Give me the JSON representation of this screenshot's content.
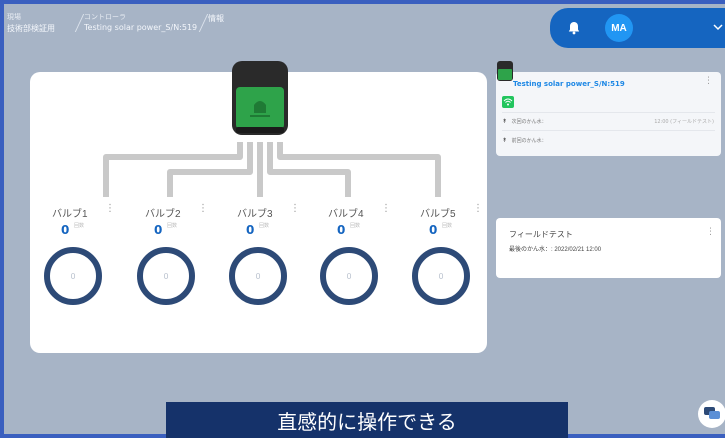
{
  "breadcrumb": [
    {
      "label": "現場",
      "value": "技術部検証用"
    },
    {
      "label": "コントローラ",
      "value": "Testing solar power_S/N:519"
    },
    {
      "label": "",
      "value": "情報"
    }
  ],
  "header": {
    "avatar_initials": "MA"
  },
  "valves": [
    {
      "name": "バルブ1",
      "count": "0",
      "unit": "回数",
      "gauge": "0"
    },
    {
      "name": "バルブ2",
      "count": "0",
      "unit": "回数",
      "gauge": "0"
    },
    {
      "name": "バルブ3",
      "count": "0",
      "unit": "回数",
      "gauge": "0"
    },
    {
      "name": "バルブ4",
      "count": "0",
      "unit": "回数",
      "gauge": "0"
    },
    {
      "name": "バルブ5",
      "count": "0",
      "unit": "回数",
      "gauge": "0"
    }
  ],
  "device_card": {
    "name": "Testing solar power_S/N:519",
    "rows": [
      {
        "label": "次回のかん水：",
        "value": "12:00 (フィールドテスト)"
      },
      {
        "label": "前回のかん水：",
        "value": ""
      }
    ]
  },
  "schedule_card": {
    "title": "フィールドテスト",
    "last_label": "最後のかん水：",
    "last_value": ": 2022/02/21 12:00"
  },
  "banner": {
    "text": "直感的に操作できる"
  },
  "colors": {
    "primary": "#1565c0",
    "gauge": "#2d4a77",
    "banner": "#15326a",
    "background": "#a7b4c6"
  }
}
